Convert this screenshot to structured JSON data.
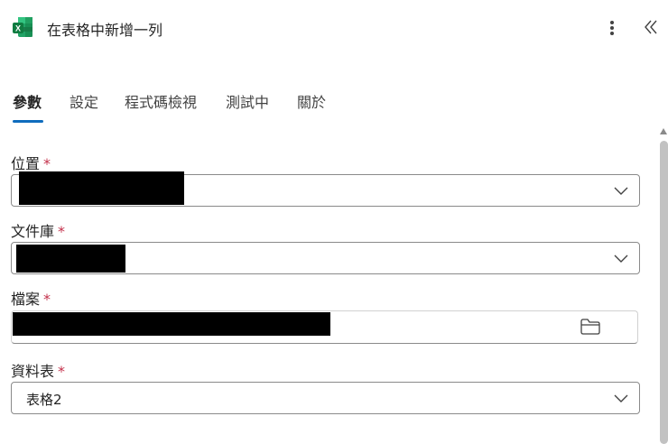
{
  "header": {
    "title": "在表格中新增一列",
    "app_icon": "excel-icon",
    "more_icon": "more-vertical-icon",
    "collapse_icon": "double-chevron-left-icon"
  },
  "tabs": [
    {
      "label": "參數",
      "active": true
    },
    {
      "label": "設定",
      "active": false
    },
    {
      "label": "程式碼檢視",
      "active": false
    },
    {
      "label": "測試中",
      "active": false
    },
    {
      "label": "關於",
      "active": false
    }
  ],
  "fields": {
    "location": {
      "label": "位置",
      "required_mark": "*",
      "value": "[redacted]"
    },
    "library": {
      "label": "文件庫",
      "required_mark": "*",
      "value": "[redacted]"
    },
    "file": {
      "label": "檔案",
      "required_mark": "*",
      "value": "[redacted]",
      "action_icon": "folder-icon"
    },
    "table": {
      "label": "資料表",
      "required_mark": "*",
      "value": "表格2"
    }
  },
  "colors": {
    "accent": "#0f6cbd",
    "required": "#c4314b",
    "excel_green": "#107c41"
  }
}
